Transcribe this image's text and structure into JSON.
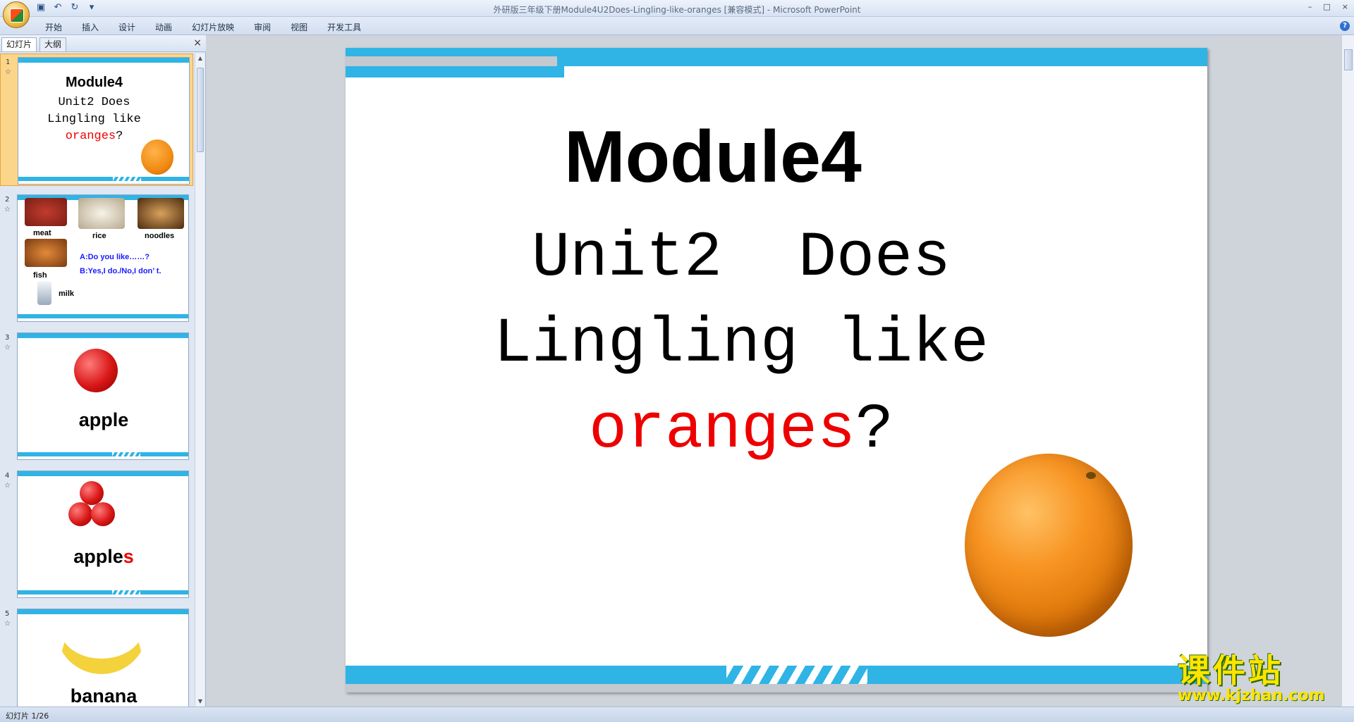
{
  "window": {
    "title": "外研版三年级下册Module4U2Does-Lingling-like-oranges [兼容模式] - Microsoft PowerPoint",
    "controls": [
      "–",
      "□",
      "×"
    ]
  },
  "quick_access": [
    "save-icon",
    "undo-icon",
    "redo-icon",
    "customize-icon"
  ],
  "ribbon": {
    "tabs": [
      "开始",
      "插入",
      "设计",
      "动画",
      "幻灯片放映",
      "审阅",
      "视图",
      "开发工具"
    ],
    "help": "?"
  },
  "left_panel": {
    "tabs": [
      "幻灯片",
      "大纲"
    ],
    "close": "×",
    "slides": [
      {
        "num": "1",
        "title": "Module4",
        "line1": "Unit2  Does",
        "line2": "Lingling like",
        "line3_red": "oranges",
        "line3_rest": "?"
      },
      {
        "num": "2",
        "foods": [
          "meat",
          "rice",
          "noodles",
          "fish",
          "milk"
        ],
        "dialog_a": "A:Do you  like……?",
        "dialog_b": "B:Yes,I do./No,I  don’ t."
      },
      {
        "num": "3",
        "word": "apple"
      },
      {
        "num": "4",
        "word": "apple",
        "word_red": "s"
      },
      {
        "num": "5",
        "word": "banana"
      }
    ]
  },
  "slide": {
    "title": "Module4",
    "line1": "Unit2  Does",
    "line2": "Lingling like",
    "line3_red": "oranges",
    "line3_rest": "?"
  },
  "watermark": {
    "cn": "课件站",
    "url": "www.kjzhan.com"
  },
  "status": {
    "slide_info": "幻灯片 1/26"
  },
  "colors": {
    "accent_blue": "#2fb4e5",
    "red_text": "#ee0000",
    "selected_thumb": "#fbd58a"
  }
}
